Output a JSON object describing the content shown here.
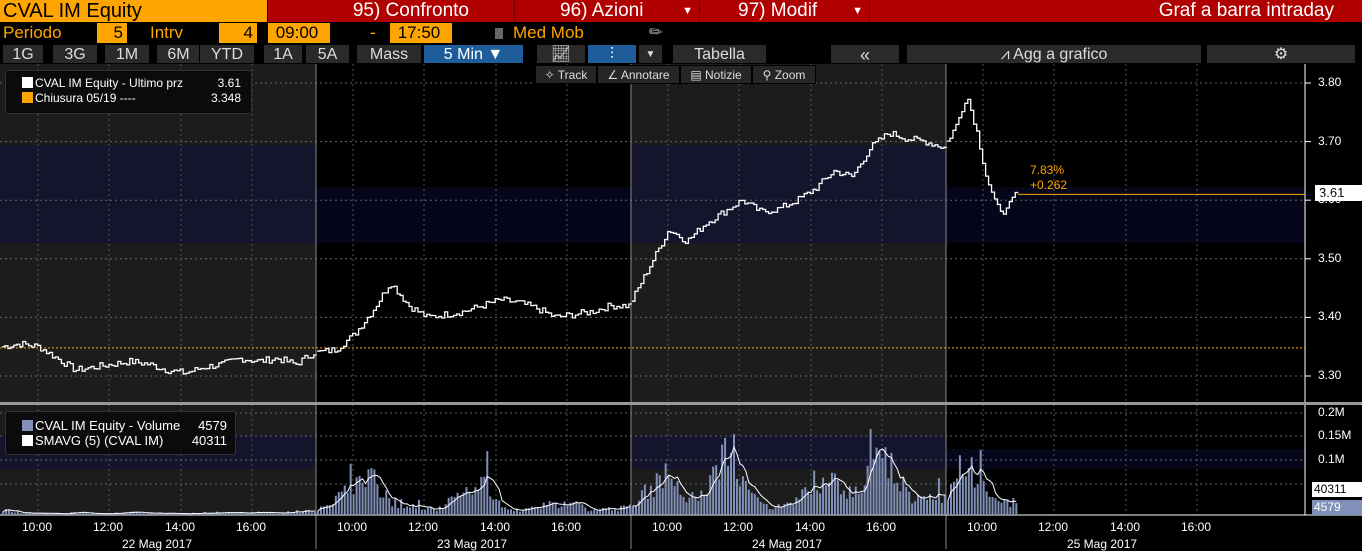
{
  "header": {
    "ticker": "CVAL IM Equity",
    "btn1": "95) Confronto",
    "btn2": "96) Azioni",
    "btn3": "97) Modif",
    "title": "Graf a barra intraday"
  },
  "params": {
    "periodo_label": "Periodo",
    "periodo": "5",
    "intrv_label": "Intrv",
    "intrv": "4",
    "start": "09:00",
    "dash": "-",
    "end": "17:50",
    "med_mob": "Med Mob"
  },
  "ranges": [
    "1G",
    "3G",
    "1M",
    "6M",
    "YTD",
    "1A",
    "5A",
    "Mass"
  ],
  "interval": "5 Min ▼",
  "toolbar": {
    "tabella": "Tabella",
    "collapse": "«",
    "add": "Agg a grafico",
    "settings": "⚙"
  },
  "tools": [
    "Track",
    "Annotare",
    "Notizie",
    "Zoom"
  ],
  "legend_price": {
    "l1": "CVAL IM Equity - Ultimo prz",
    "v1": "3.61",
    "l2": "Chiusura 05/19 ----",
    "v2": "3.348"
  },
  "legend_vol": {
    "l1": "CVAL IM Equity - Volume",
    "v1": "4579",
    "l2": "SMAVG (5) (CVAL IM)",
    "v2": "40311"
  },
  "change": {
    "pct": "7.83%",
    "abs": "+0.262"
  },
  "last_price": "3.61",
  "last_vol": "40311",
  "last_vol2": "4579",
  "colors": {
    "accent": "#ffa500",
    "header_red": "#b00000",
    "volume": "#8090b8"
  },
  "chart_data": {
    "type": "line",
    "price_axis": {
      "ticks": [
        "3.80",
        "3.70",
        "3.60",
        "3.50",
        "3.40",
        "3.30"
      ],
      "range": [
        3.27,
        3.83
      ]
    },
    "volume_axis": {
      "ticks": [
        "0.2M",
        "0.15M",
        "0.1M"
      ],
      "range": [
        0,
        210000
      ]
    },
    "prev_close": 3.348,
    "time_labels": [
      "10:00",
      "12:00",
      "14:00",
      "16:00"
    ],
    "dates": [
      "22 Mag 2017",
      "23 Mag 2017",
      "24 Mag 2017",
      "25 Mag 2017"
    ],
    "price_series": [
      [
        3.35,
        3.355,
        3.35,
        3.33,
        3.31,
        3.315,
        3.32,
        3.325,
        3.32,
        3.31,
        3.305,
        3.315,
        3.32,
        3.33,
        3.325,
        3.33,
        3.32,
        3.34
      ],
      [
        3.34,
        3.345,
        3.37,
        3.41,
        3.46,
        3.42,
        3.4,
        3.405,
        3.41,
        3.42,
        3.43,
        3.425,
        3.415,
        3.4,
        3.405,
        3.41,
        3.42,
        3.42
      ],
      [
        3.43,
        3.49,
        3.55,
        3.53,
        3.56,
        3.58,
        3.6,
        3.58,
        3.585,
        3.6,
        3.62,
        3.65,
        3.64,
        3.69,
        3.715,
        3.705,
        3.7,
        3.69
      ],
      [
        3.7,
        3.73,
        3.78,
        3.72,
        3.64,
        3.59,
        3.58,
        3.61
      ]
    ],
    "volume_series": [
      [
        12,
        5,
        4,
        3,
        6,
        3,
        4,
        8,
        5,
        4,
        3,
        5,
        6,
        4,
        7,
        5,
        9,
        8
      ],
      [
        10,
        40,
        60,
        80,
        35,
        20,
        12,
        25,
        60,
        70,
        18,
        12,
        20,
        25,
        30,
        10,
        15,
        18
      ],
      [
        30,
        70,
        85,
        40,
        50,
        130,
        70,
        25,
        20,
        30,
        90,
        80,
        40,
        110,
        125,
        50,
        40,
        35
      ],
      [
        40,
        90,
        140,
        80,
        60,
        35,
        30,
        40
      ]
    ]
  }
}
